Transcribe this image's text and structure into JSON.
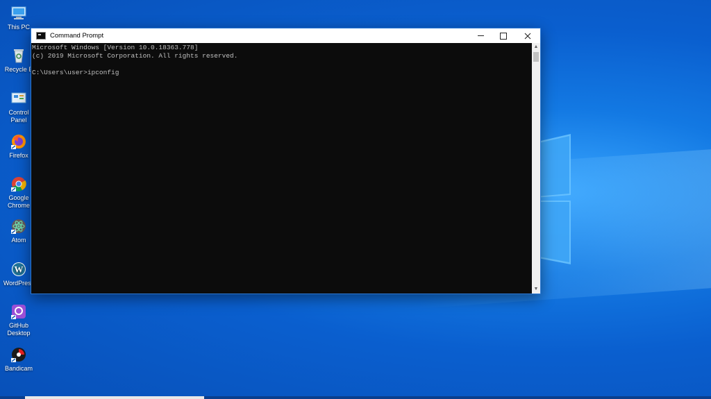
{
  "desktop": {
    "icons": [
      {
        "label": "This PC",
        "icon": "computer-icon"
      },
      {
        "label": "Recycle B",
        "icon": "recycle-bin-icon"
      },
      {
        "label": "Control Panel",
        "icon": "control-panel-icon"
      },
      {
        "label": "Firefox",
        "icon": "firefox-icon"
      },
      {
        "label": "Google Chrome",
        "icon": "chrome-icon"
      },
      {
        "label": "Atom",
        "icon": "atom-icon"
      },
      {
        "label": "WordPress",
        "icon": "wordpress-icon"
      },
      {
        "label": "GitHub Desktop",
        "icon": "github-desktop-icon"
      },
      {
        "label": "Bandicam",
        "icon": "bandicam-icon"
      }
    ],
    "colors": {
      "background": "#0a5fcf",
      "accent": "#39a6ff"
    }
  },
  "window": {
    "title": "Command Prompt",
    "console_lines": [
      "Microsoft Windows [Version 10.0.18363.778]",
      "(c) 2019 Microsoft Corporation. All rights reserved.",
      "",
      "C:\\Users\\user>ipconfig"
    ]
  }
}
